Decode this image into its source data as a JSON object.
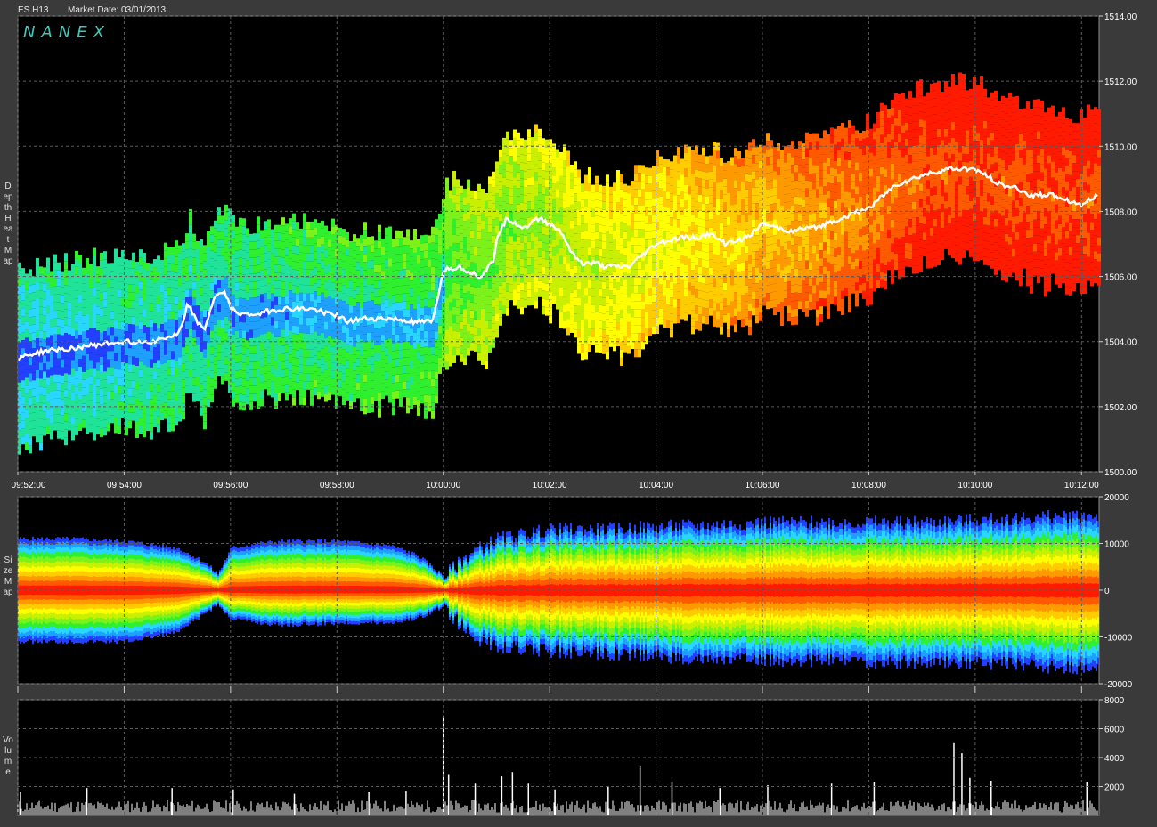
{
  "header": {
    "symbol": "ES.H13",
    "market_date": "Market Date: 03/01/2013"
  },
  "brand": "NANEX",
  "colors": {
    "background": "#000000",
    "frame": "#3a3a3a",
    "grid": "#5a5a5a",
    "axis_text": "#ffffff",
    "price_line": "#ffffff",
    "heat_scale": [
      "#2440ff",
      "#1ea0ff",
      "#29d6ff",
      "#20e39a",
      "#2ef02e",
      "#7df21a",
      "#c8f000",
      "#ffff00",
      "#ffcc00",
      "#ff9900",
      "#ff5a00",
      "#ff1a00"
    ],
    "volume_bar": "#ffffff"
  },
  "chart_data": [
    {
      "type": "heatmap",
      "panel": "depth-heat-map",
      "ylabel": "Depth Heat Map",
      "x_ticks": [
        "09:52:00",
        "09:54:00",
        "09:56:00",
        "09:58:00",
        "10:00:00",
        "10:02:00",
        "10:04:00",
        "10:06:00",
        "10:08:00",
        "10:10:00",
        "10:12:00"
      ],
      "x_range_minutes": [
        0,
        20.33
      ],
      "y_ticks": [
        "1500.00",
        "1502.00",
        "1504.00",
        "1506.00",
        "1508.00",
        "1510.00",
        "1512.00",
        "1514.00"
      ],
      "ylim": [
        1500,
        1514
      ],
      "grid": true,
      "price_series": {
        "name": "",
        "x": [
          0,
          0.5,
          1,
          1.5,
          2,
          2.5,
          3,
          3.1,
          3.2,
          3.3,
          3.5,
          3.7,
          3.9,
          4,
          4.3,
          4.6,
          5,
          5.5,
          6,
          6.2,
          6.5,
          7,
          7.5,
          7.8,
          8,
          8.3,
          8.7,
          8.95,
          9,
          9.2,
          9.5,
          9.8,
          10,
          10.2,
          10.4,
          10.6,
          10.9,
          11,
          11.5,
          11.7,
          12,
          12.5,
          12.8,
          13,
          13.3,
          13.7,
          14,
          14.5,
          15,
          15.5,
          16,
          16.5,
          17,
          17.5,
          18,
          18.5,
          18.8,
          19,
          19.5,
          20,
          20.3
        ],
        "y": [
          1503.5,
          1503.7,
          1503.8,
          1503.9,
          1504,
          1504,
          1504.2,
          1504.5,
          1505.2,
          1504.8,
          1504.3,
          1505.4,
          1505.5,
          1505,
          1504.8,
          1504.9,
          1505,
          1505,
          1504.8,
          1504.6,
          1504.7,
          1504.7,
          1504.6,
          1504.6,
          1506.2,
          1506.3,
          1506,
          1506.5,
          1507.2,
          1507.8,
          1507.5,
          1507.8,
          1507.6,
          1507.4,
          1506.8,
          1506.4,
          1506.4,
          1506.3,
          1506.3,
          1506.6,
          1507,
          1507.2,
          1507.2,
          1507.3,
          1507,
          1507.2,
          1507.6,
          1507.4,
          1507.5,
          1507.8,
          1508.1,
          1508.8,
          1509.1,
          1509.3,
          1509.3,
          1508.8,
          1508.7,
          1508.5,
          1508.5,
          1508.2,
          1508.5
        ]
      }
    },
    {
      "type": "heatmap",
      "panel": "size-map",
      "ylabel": "Size Map",
      "y_ticks": [
        "20000",
        "10000",
        "0",
        "-10000",
        "-20000"
      ],
      "ylim": [
        -20000,
        20000
      ],
      "grid": true,
      "envelope": {
        "x": [
          0,
          1,
          2,
          3,
          3.5,
          3.75,
          3.85,
          4,
          4.5,
          5,
          6,
          7,
          7.5,
          8,
          8.5,
          9,
          9.5,
          10,
          11,
          12,
          13,
          14,
          15,
          16,
          17,
          18,
          19,
          20,
          20.3
        ],
        "upper": [
          11000,
          11000,
          10500,
          9000,
          6000,
          3500,
          5500,
          9000,
          10000,
          10500,
          10500,
          9500,
          7500,
          3000,
          8000,
          11000,
          12000,
          13000,
          13000,
          13500,
          14000,
          14500,
          14500,
          14500,
          14500,
          15000,
          15500,
          16000,
          16000
        ],
        "lower": [
          -11000,
          -11000,
          -11000,
          -9000,
          -5000,
          -3000,
          -4500,
          -6000,
          -7000,
          -7500,
          -7000,
          -7000,
          -6000,
          -3500,
          -10000,
          -12000,
          -12500,
          -13000,
          -13500,
          -14000,
          -15000,
          -15000,
          -15000,
          -15500,
          -15500,
          -15500,
          -16000,
          -17000,
          -17000
        ]
      }
    },
    {
      "type": "bar",
      "panel": "volume",
      "ylabel": "Volume",
      "y_ticks": [
        "8000",
        "6000",
        "4000",
        "2000"
      ],
      "ylim": [
        0,
        8000
      ],
      "grid": true,
      "spikes": {
        "x": [
          0.05,
          1.3,
          2.9,
          4.05,
          5.2,
          6.6,
          7.3,
          8.0,
          8.1,
          8.6,
          9.1,
          9.3,
          9.6,
          10.1,
          11.1,
          11.7,
          12.3,
          13.2,
          14.1,
          15.3,
          16.1,
          17.6,
          17.75,
          17.9,
          18.3,
          20.1
        ],
        "values": [
          1600,
          1900,
          1900,
          1800,
          1500,
          1600,
          1700,
          6900,
          2800,
          2200,
          2700,
          3000,
          2200,
          1800,
          2000,
          3400,
          2300,
          1900,
          2100,
          2200,
          2300,
          5000,
          4300,
          2600,
          2400,
          2300
        ]
      },
      "baseline_level": 700
    }
  ]
}
